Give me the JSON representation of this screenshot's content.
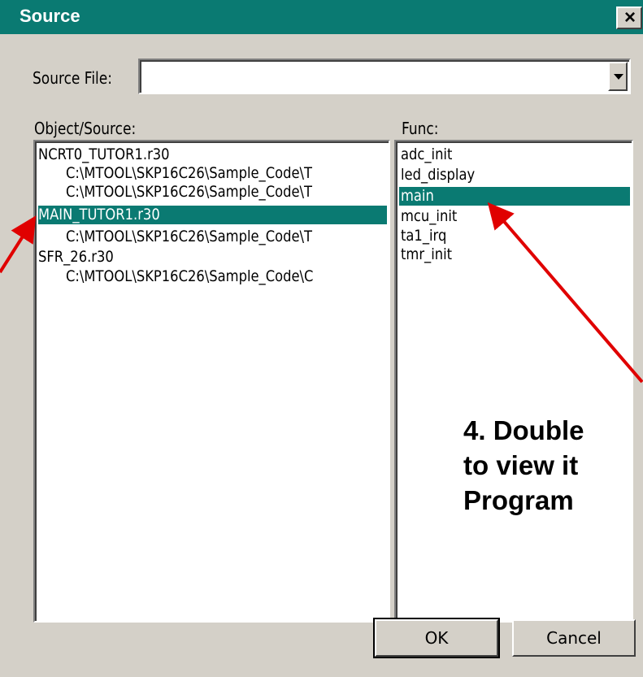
{
  "window": {
    "title": "Source",
    "close_glyph": "✕"
  },
  "source_file": {
    "label": "Source File:",
    "value": ""
  },
  "object_source": {
    "label": "Object/Source:",
    "items": [
      {
        "text": "NCRT0_TUTOR1.r30",
        "indent": 0,
        "selected": false
      },
      {
        "text": "C:\\MTOOL\\SKP16C26\\Sample_Code\\T",
        "indent": 1,
        "selected": false
      },
      {
        "text": "C:\\MTOOL\\SKP16C26\\Sample_Code\\T",
        "indent": 1,
        "selected": false
      },
      {
        "text": "MAIN_TUTOR1.r30",
        "indent": 0,
        "selected": true
      },
      {
        "text": "C:\\MTOOL\\SKP16C26\\Sample_Code\\T",
        "indent": 1,
        "selected": false
      },
      {
        "text": "SFR_26.r30",
        "indent": 0,
        "selected": false
      },
      {
        "text": "C:\\MTOOL\\SKP16C26\\Sample_Code\\C",
        "indent": 1,
        "selected": false
      }
    ]
  },
  "func": {
    "label": "Func:",
    "items": [
      {
        "text": "adc_init",
        "selected": false
      },
      {
        "text": "led_display",
        "selected": false
      },
      {
        "text": "main",
        "selected": true
      },
      {
        "text": "mcu_init",
        "selected": false
      },
      {
        "text": "ta1_irq",
        "selected": false
      },
      {
        "text": "tmr_init",
        "selected": false
      }
    ]
  },
  "buttons": {
    "ok": "OK",
    "cancel": "Cancel"
  },
  "annotation": {
    "lines": [
      "4. Double",
      "to view it",
      "Program"
    ],
    "color": "#e00000"
  },
  "colors": {
    "selection": "#0a7a72",
    "dialog_bg": "#d4d0c8"
  }
}
